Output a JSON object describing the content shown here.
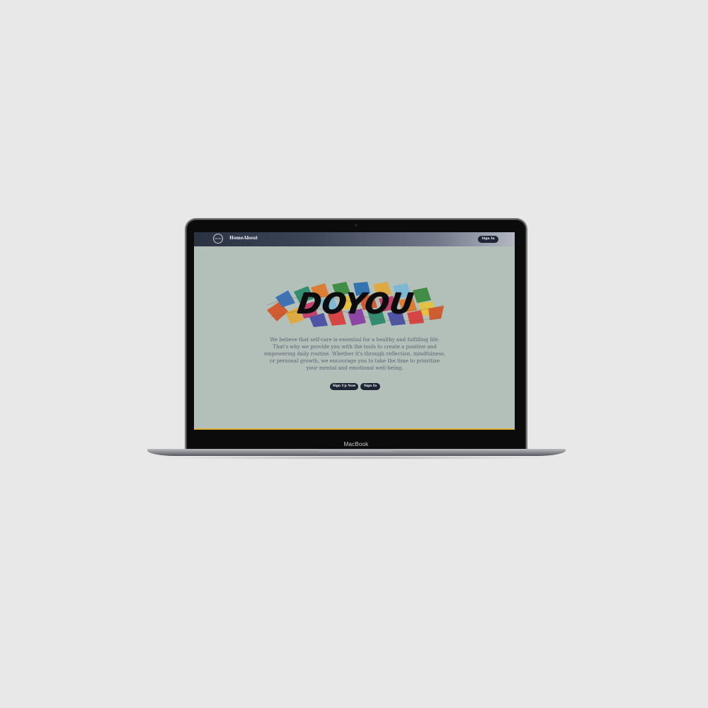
{
  "device": {
    "model_label": "MacBook"
  },
  "site": {
    "logo_text": "DOYOU",
    "nav": {
      "home": "Home",
      "about": "About"
    },
    "top_signin_label": "Sign In",
    "hero_title": "DOYOU",
    "blurb": "We believe that self-care is essential for a healthy and fulfilling life. That's why we provide you with the tools to create a positive and empowering daily routine. Whether it's through reflection, mindfulness, or personal growth, we encourage you to take the time to prioritize your mental and emotional well-being.",
    "cta_signup_label": "Sign Up Now",
    "cta_signin_label": "Sign In"
  },
  "colors": {
    "page_bg": "#e8e8e8",
    "screen_bg": "#b3bfb9",
    "navbar_start": "#2a3242",
    "navbar_end": "#b3b8c3",
    "button_bg": "#1e2636",
    "accent_line": "#d9b23a",
    "text_muted": "#5c6370"
  },
  "icons": {
    "logo": "circle-logo-icon",
    "hero_art": "colorful-pattern-art-icon"
  }
}
